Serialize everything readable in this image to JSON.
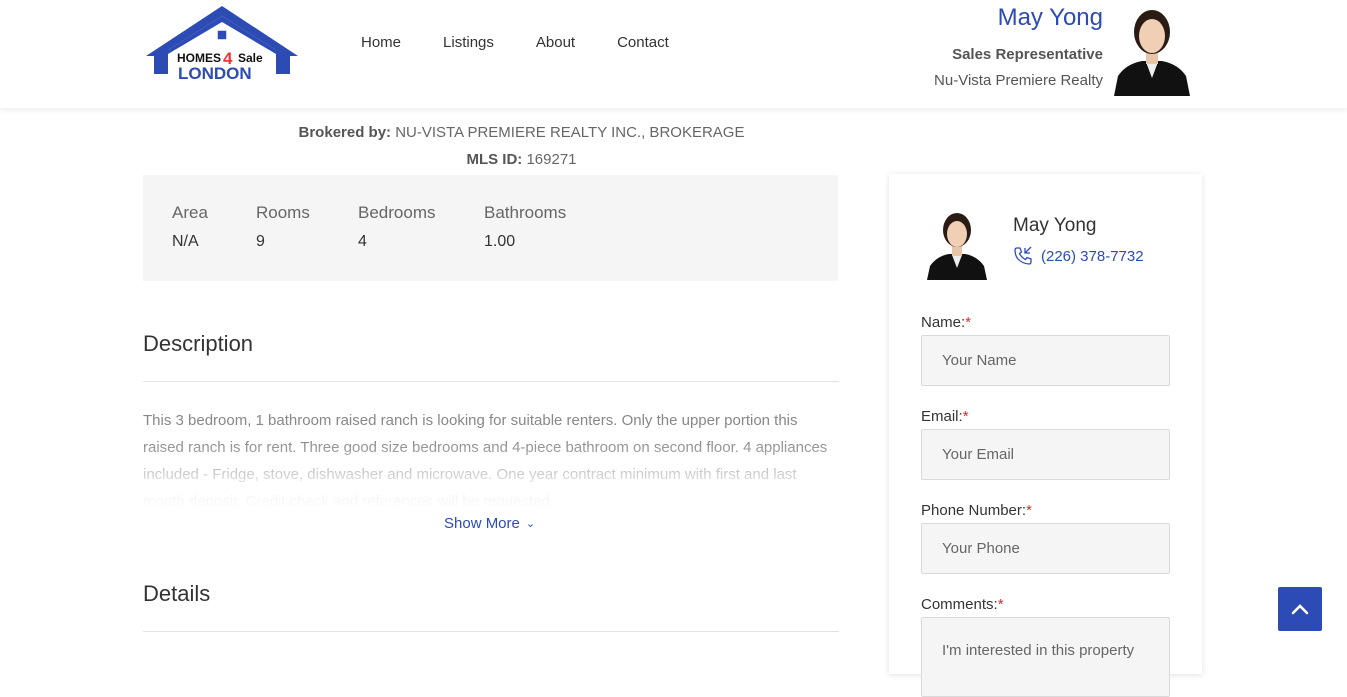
{
  "logo": {
    "line1": "HOMES",
    "number": "4",
    "line1b": "Sale",
    "line2": "LONDON"
  },
  "nav": {
    "items": [
      {
        "label": "Home"
      },
      {
        "label": "Listings"
      },
      {
        "label": "About"
      },
      {
        "label": "Contact"
      }
    ]
  },
  "agent": {
    "name": "May Yong",
    "role": "Sales Representative",
    "office": "Nu-Vista Premiere Realty",
    "phone": "(226) 378-7732"
  },
  "listing": {
    "brokered_label": "Brokered by:",
    "brokered_value": "NU-VISTA PREMIERE REALTY INC., BROKERAGE",
    "mls_label": "MLS ID:",
    "mls_value": "169271",
    "stats": [
      {
        "label": "Area",
        "value": "N/A"
      },
      {
        "label": "Rooms",
        "value": "9"
      },
      {
        "label": "Bedrooms",
        "value": "4"
      },
      {
        "label": "Bathrooms",
        "value": "1.00"
      }
    ]
  },
  "description": {
    "title": "Description",
    "text": "This 3 bedroom, 1 bathroom raised ranch is looking for suitable renters. Only the upper portion this raised ranch is for rent. Three good size bedrooms and 4-piece bathroom on second floor. 4 appliances included - Fridge, stove, dishwasher and microwave. One year contract minimum with first and last month deposit. Credit check and references will be requested.",
    "show_more": "Show More"
  },
  "details": {
    "title": "Details"
  },
  "form": {
    "name_label": "Name:",
    "name_placeholder": "Your Name",
    "email_label": "Email:",
    "email_placeholder": "Your Email",
    "phone_label": "Phone Number:",
    "phone_placeholder": "Your Phone",
    "comments_label": "Comments:",
    "comments_placeholder": "I'm interested in this property",
    "required_mark": "*"
  },
  "colors": {
    "accent": "#2d4bb5",
    "required": "#d32f2f",
    "stats_bg": "#f5f5f5"
  }
}
